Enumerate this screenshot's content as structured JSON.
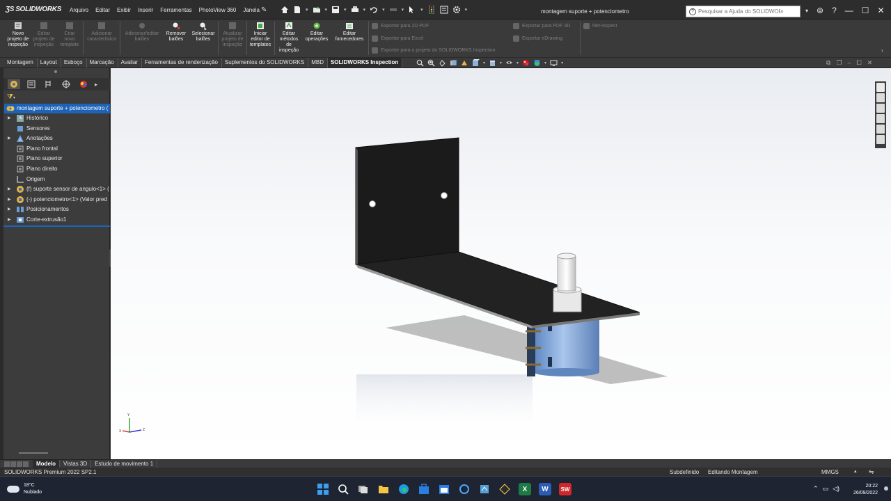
{
  "app": {
    "logo": "SOLIDWORKS",
    "menus": [
      "Arquivo",
      "Editar",
      "Exibir",
      "Inserir",
      "Ferramentas",
      "PhotoView 360",
      "Janela"
    ],
    "document_title": "montagem suporte + potenciometro",
    "search_placeholder": "Pesquisar a Ajuda do SOLIDWORKS"
  },
  "command_manager": {
    "buttons": [
      {
        "label": "Novo projeto de inspeção",
        "enabled": true
      },
      {
        "label": "Editar projeto de inspeção",
        "enabled": false
      },
      {
        "label": "Criar novo template",
        "enabled": false
      },
      {
        "label": "Adicionar característica",
        "enabled": false
      },
      {
        "label": "Adicionar/editar balões",
        "enabled": false
      },
      {
        "label": "Remover balões",
        "enabled": true
      },
      {
        "label": "Selecionar balões",
        "enabled": true
      },
      {
        "label": "Atualizar projeto de inspeção",
        "enabled": false
      },
      {
        "label": "Iniciar editor de templates",
        "enabled": true
      },
      {
        "label": "Editar métodos de inspeção",
        "enabled": true
      },
      {
        "label": "Editar operações",
        "enabled": true
      },
      {
        "label": "Editar fornecedores",
        "enabled": true
      }
    ],
    "exports": {
      "pdf2d": "Exportar para 2D PDF",
      "excel": "Exportar para Excel",
      "project": "Exportar para o projeto do SOLIDWORKS Inspection",
      "pdf3d": "Exportar para PDF 3D",
      "edrawing": "Exportar eDrawing",
      "netinspect": "Net-inspect"
    }
  },
  "tabs": [
    "Montagem",
    "Layout",
    "Esboço",
    "Marcação",
    "Avaliar",
    "Ferramentas de renderização",
    "Suplementos do SOLIDWORKS",
    "MBD",
    "SOLIDWORKS Inspection"
  ],
  "active_tab": "SOLIDWORKS Inspection",
  "feature_tree": {
    "root": "montagem suporte + potenciometro (",
    "items": [
      {
        "label": "Histórico",
        "expandable": true,
        "icon": "history-icon"
      },
      {
        "label": "Sensores",
        "expandable": false,
        "icon": "sensor-icon"
      },
      {
        "label": "Anotações",
        "expandable": true,
        "icon": "annotation-icon"
      },
      {
        "label": "Plano frontal",
        "expandable": false,
        "icon": "plane-icon"
      },
      {
        "label": "Plano superior",
        "expandable": false,
        "icon": "plane-icon"
      },
      {
        "label": "Plano direito",
        "expandable": false,
        "icon": "plane-icon"
      },
      {
        "label": "Origem",
        "expandable": false,
        "icon": "origin-icon"
      },
      {
        "label": "(f) suporte sensor de angulo<1> (",
        "expandable": true,
        "icon": "part-icon"
      },
      {
        "label": "(-) potenciometro<1> (Valor pred",
        "expandable": true,
        "icon": "part-icon"
      },
      {
        "label": "Posicionamentos",
        "expandable": true,
        "icon": "mates-icon"
      },
      {
        "label": "Corte-extrusão1",
        "expandable": true,
        "icon": "cut-extrude-icon"
      }
    ]
  },
  "bottom_tabs": [
    "Modelo",
    "Vistas 3D",
    "Estudo de movimento 1"
  ],
  "active_bottom_tab": "Modelo",
  "status": {
    "product": "SOLIDWORKS Premium 2022 SP2.1",
    "definition": "Subdefinido",
    "mode": "Editando Montagem",
    "units": "MMGS"
  },
  "taskbar": {
    "weather_temp": "18°C",
    "weather_desc": "Nublado",
    "time": "20:22",
    "date": "26/09/2022"
  },
  "colors": {
    "accent": "#1d63b8",
    "bracket": "#1a1a1a",
    "potentiometer_body": "#7fa6d6",
    "shaft": "#f2f2f2"
  }
}
